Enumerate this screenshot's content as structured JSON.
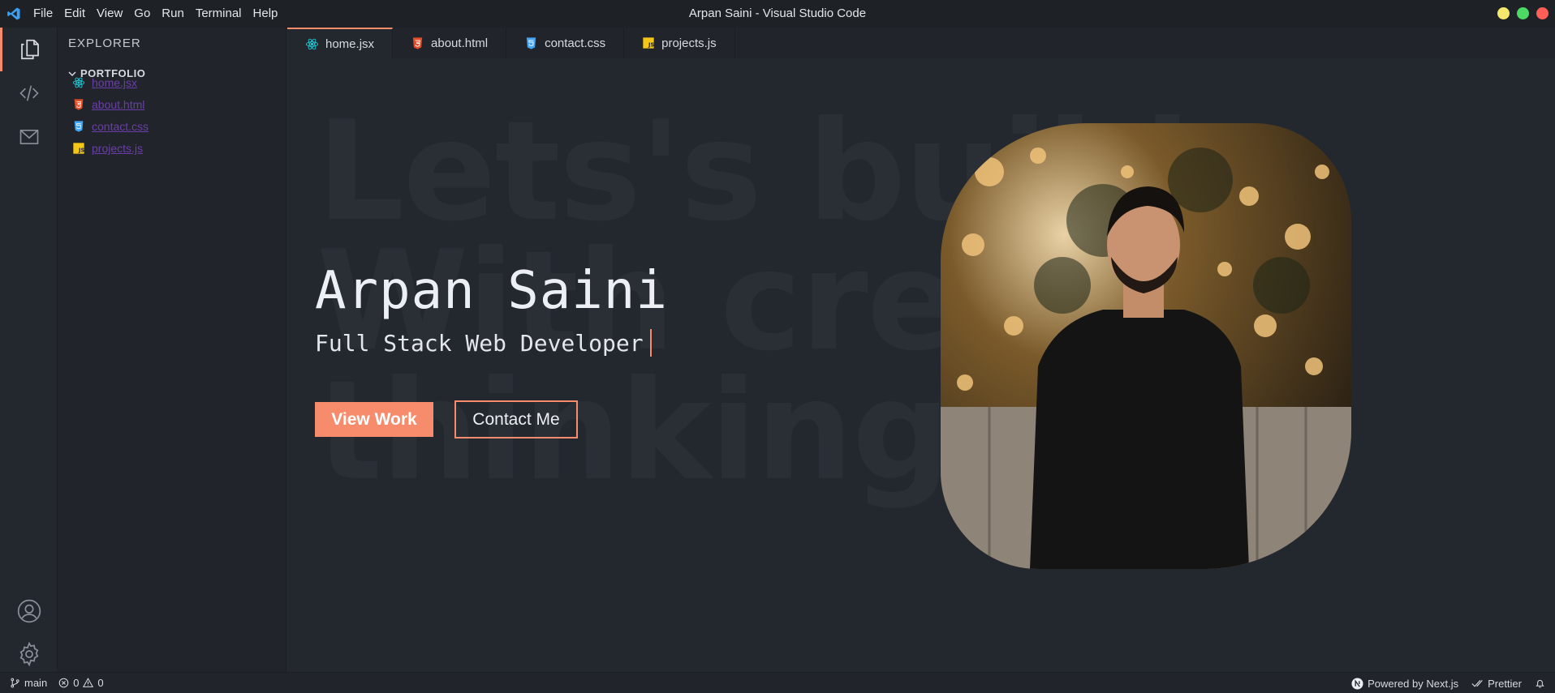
{
  "window": {
    "title": "Arpan Saini - Visual Studio Code",
    "menu": [
      "File",
      "Edit",
      "View",
      "Go",
      "Run",
      "Terminal",
      "Help"
    ],
    "controls": {
      "minimize_color": "#f5e86b",
      "maximize_color": "#4cd964",
      "close_color": "#ff5f57"
    }
  },
  "activity_bar": {
    "top_items": [
      "files-icon",
      "code-icon",
      "mail-icon"
    ],
    "bottom_items": [
      "account-icon",
      "gear-icon"
    ]
  },
  "sidebar": {
    "title": "EXPLORER",
    "folder": "PORTFOLIO",
    "files": [
      {
        "name": "home.jsx",
        "icon": "react-icon"
      },
      {
        "name": "about.html",
        "icon": "html-icon"
      },
      {
        "name": "contact.css",
        "icon": "css-icon"
      },
      {
        "name": "projects.js",
        "icon": "js-icon"
      }
    ]
  },
  "tabs": [
    {
      "label": "home.jsx",
      "icon": "react-icon",
      "active": true
    },
    {
      "label": "about.html",
      "icon": "html-icon",
      "active": false
    },
    {
      "label": "contact.css",
      "icon": "css-icon",
      "active": false
    },
    {
      "label": "projects.js",
      "icon": "js-icon",
      "active": false
    }
  ],
  "hero": {
    "background_text": "Lets's build\nWith creative\nthinking",
    "name": "Arpan Saini",
    "role": "Full Stack Web Developer",
    "primary_button": "View Work",
    "secondary_button": "Contact Me",
    "photo": "portrait-photo"
  },
  "status_bar": {
    "branch": "main",
    "errors": "0",
    "warnings": "0",
    "powered_by": "Powered by Next.js",
    "formatter": "Prettier"
  },
  "colors": {
    "accent": "#f78c6c",
    "editor_bg": "#23272e",
    "sidebar_bg": "#21252b"
  }
}
